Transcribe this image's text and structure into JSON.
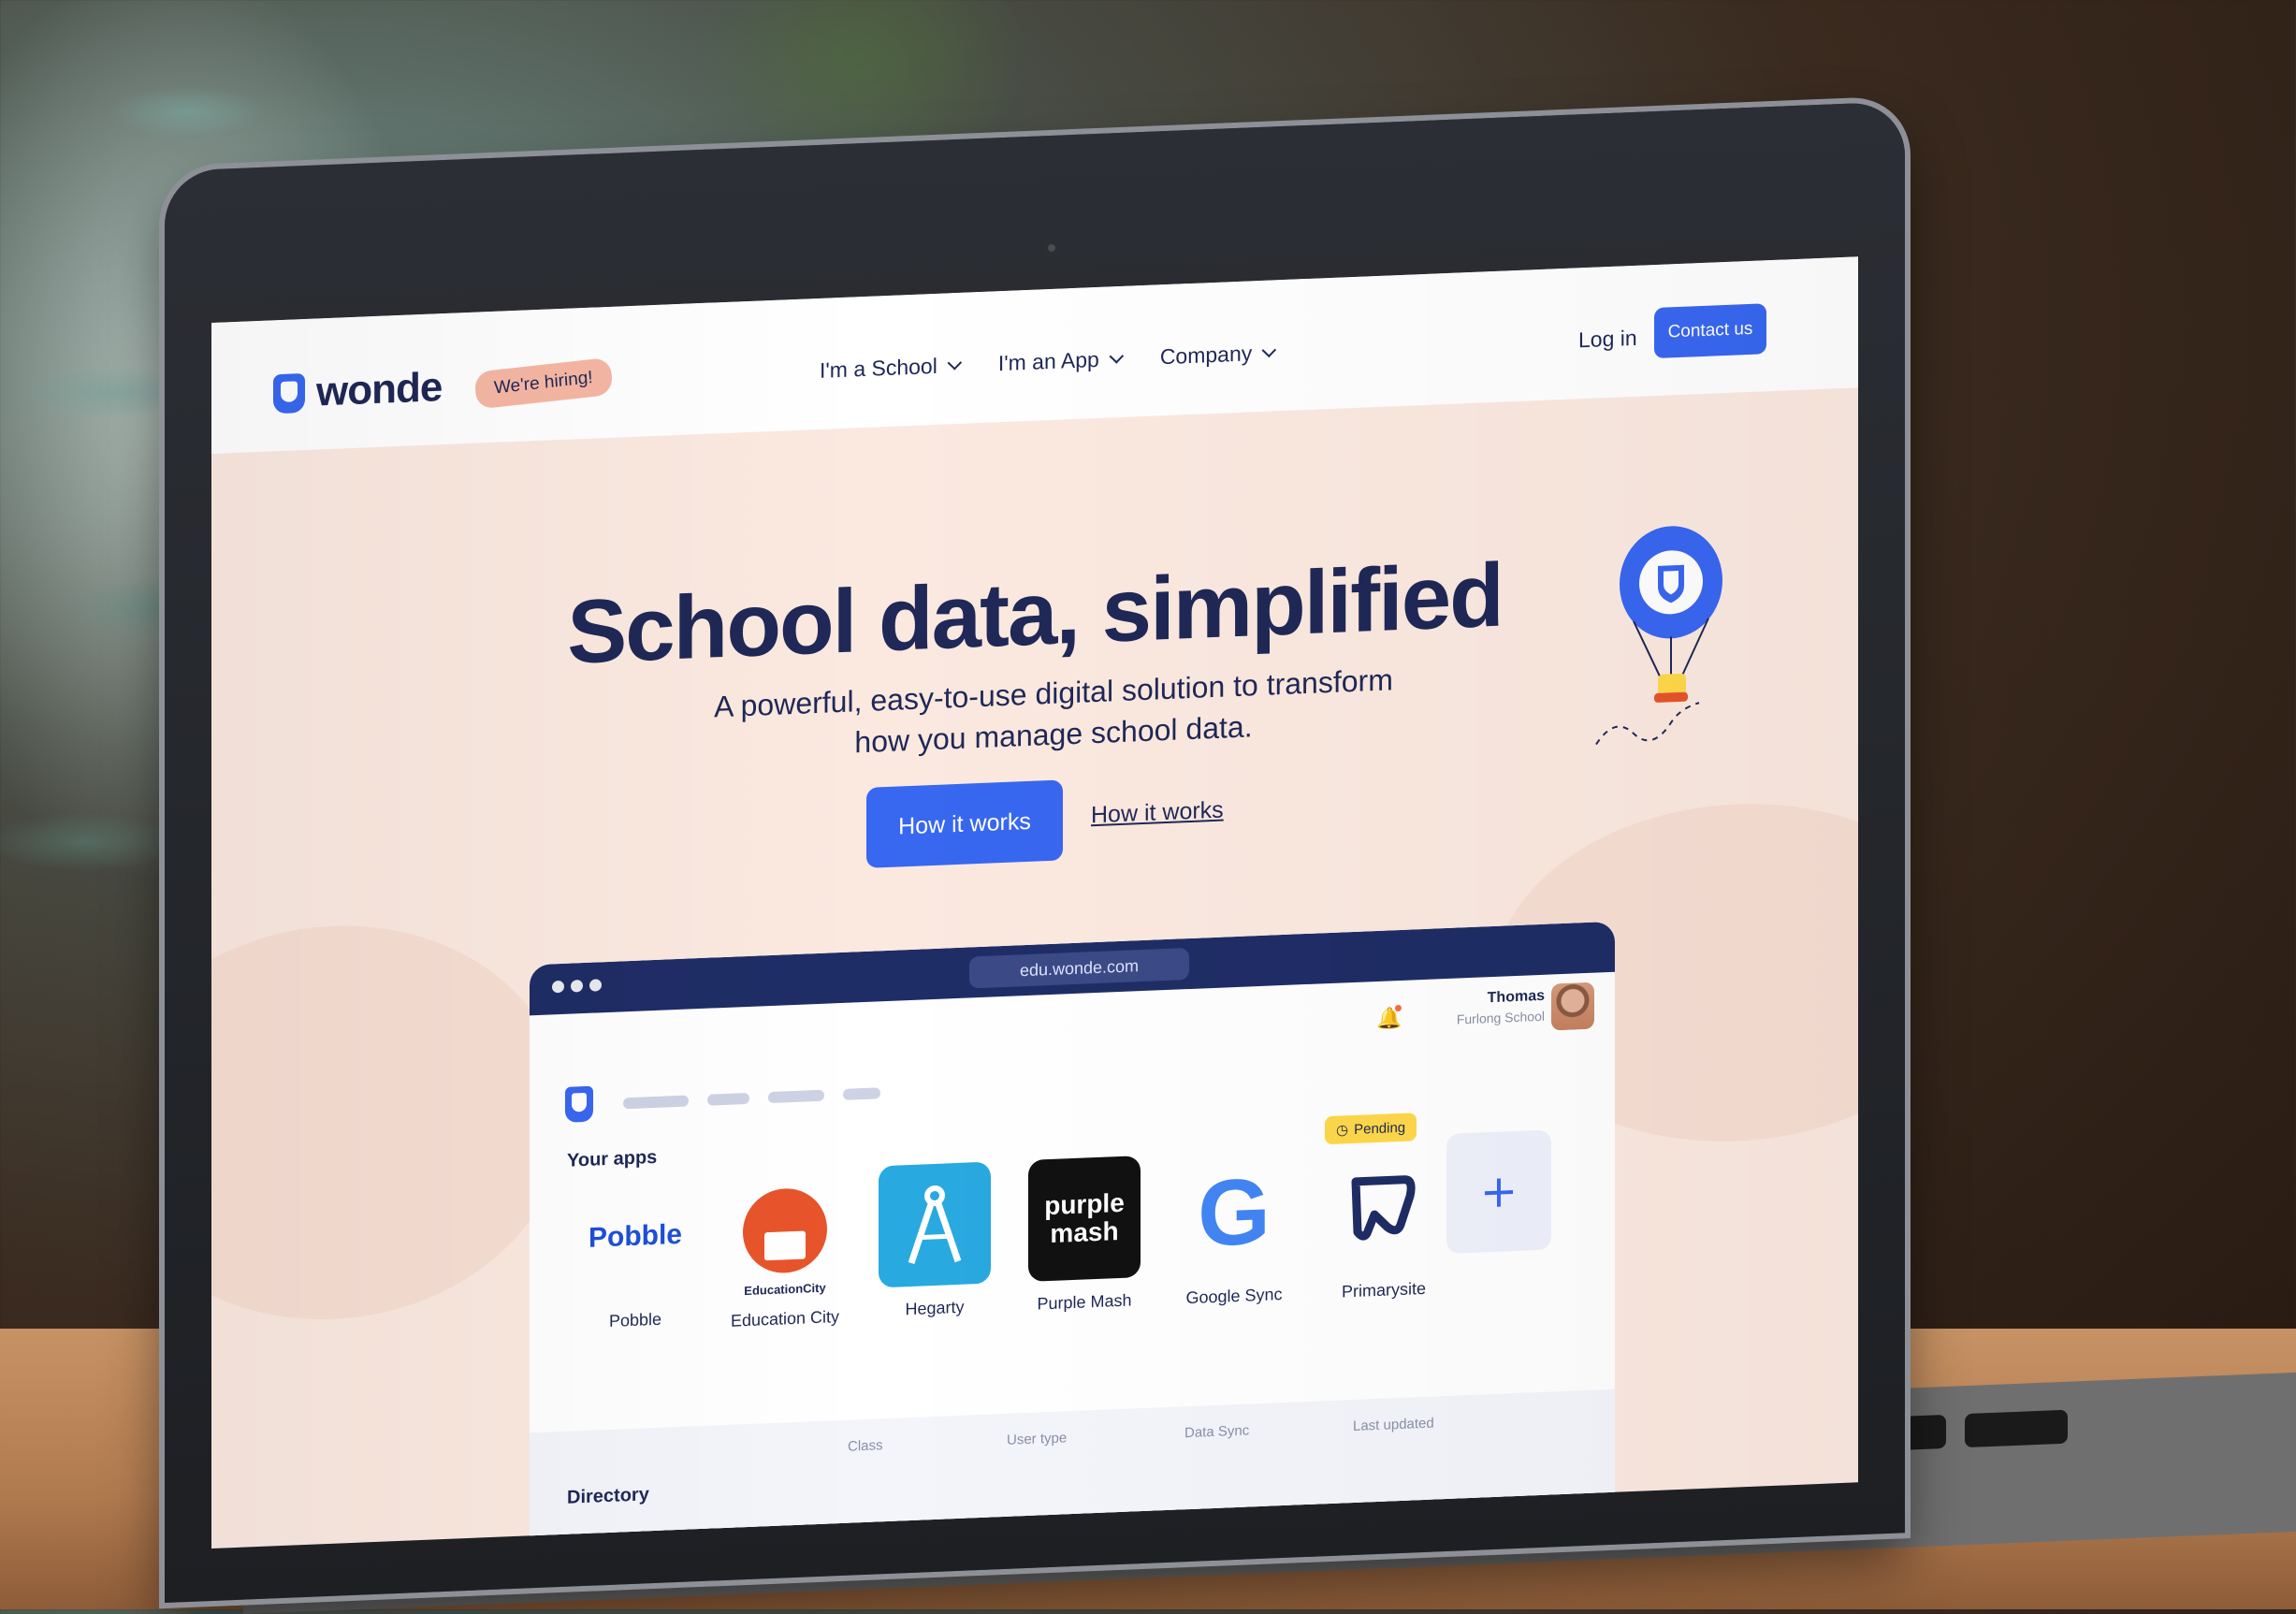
{
  "nav": {
    "brand": "wonde",
    "hiring_badge": "We're hiring!",
    "menu": [
      {
        "label": "I'm a School"
      },
      {
        "label": "I'm an App"
      },
      {
        "label": "Company"
      }
    ],
    "login": "Log in",
    "contact": "Contact us"
  },
  "hero": {
    "title": "School data, simplified",
    "subtitle": "A powerful, easy-to-use digital solution to transform how you manage school data.",
    "cta_primary": "How it works",
    "cta_secondary": "How it works"
  },
  "app_preview": {
    "url": "edu.wonde.com",
    "user_name": "Thomas",
    "user_school": "Furlong School",
    "your_apps_label": "Your apps",
    "pending_label": "Pending",
    "add_symbol": "+",
    "directory_label": "Directory",
    "apps": [
      {
        "name": "Pobble",
        "logo_text": "Pobble",
        "color": "#1e4fd8"
      },
      {
        "name": "Education City",
        "logo_text": "EducationCity",
        "color": "#e8542b"
      },
      {
        "name": "Hegarty",
        "logo_text": "",
        "color": "#28a9e0"
      },
      {
        "name": "Purple Mash",
        "logo_text": "purple mash",
        "color": "#111111"
      },
      {
        "name": "Google Sync",
        "logo_text": "G",
        "color": "#4285f4"
      },
      {
        "name": "Primarysite",
        "logo_text": "",
        "color": "#1f2d66"
      }
    ],
    "table_headers": [
      "Class",
      "User type",
      "Data Sync",
      "Last updated"
    ]
  },
  "colors": {
    "accent": "#3867f0",
    "navy": "#1f2856",
    "hero_bg": "#fbe9e0"
  }
}
